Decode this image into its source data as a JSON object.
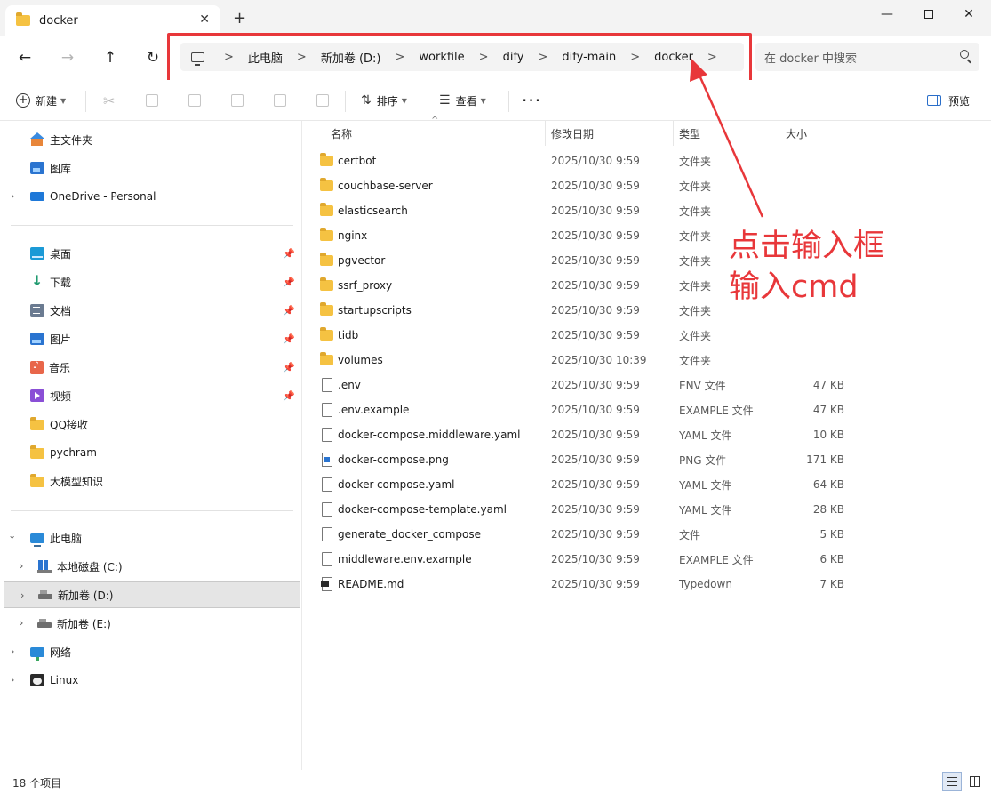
{
  "window": {
    "tab_title": "docker",
    "tab_close": "✕",
    "new_tab": "+",
    "minimize": "—",
    "close": "✕"
  },
  "nav": {
    "back": "←",
    "forward": "→",
    "up": "↑",
    "refresh": "↻"
  },
  "breadcrumb": {
    "separator": ">",
    "items": [
      "此电脑",
      "新加卷 (D:)",
      "workfile",
      "dify",
      "dify-main",
      "docker"
    ]
  },
  "search": {
    "placeholder": "在 docker 中搜索"
  },
  "toolbar": {
    "new_label": "新建",
    "sort_label": "排序",
    "view_label": "查看",
    "more_label": "···",
    "preview_label": "预览"
  },
  "sidebar": {
    "quick": [
      "主文件夹",
      "图库",
      "OneDrive - Personal"
    ],
    "pinned": [
      "桌面",
      "下载",
      "文档",
      "图片",
      "音乐",
      "视频",
      "QQ接收",
      "pychram",
      "大模型知识"
    ],
    "this_pc": "此电脑",
    "drives": [
      "本地磁盘 (C:)",
      "新加卷 (D:)",
      "新加卷 (E:)"
    ],
    "network": "网络",
    "linux": "Linux"
  },
  "columns": {
    "name": "名称",
    "date": "修改日期",
    "type": "类型",
    "size": "大小"
  },
  "files": [
    {
      "name": "certbot",
      "date": "2025/10/30 9:59",
      "type": "文件夹",
      "size": "",
      "icon": "folder-icon"
    },
    {
      "name": "couchbase-server",
      "date": "2025/10/30 9:59",
      "type": "文件夹",
      "size": "",
      "icon": "folder-icon"
    },
    {
      "name": "elasticsearch",
      "date": "2025/10/30 9:59",
      "type": "文件夹",
      "size": "",
      "icon": "folder-icon"
    },
    {
      "name": "nginx",
      "date": "2025/10/30 9:59",
      "type": "文件夹",
      "size": "",
      "icon": "folder-icon"
    },
    {
      "name": "pgvector",
      "date": "2025/10/30 9:59",
      "type": "文件夹",
      "size": "",
      "icon": "folder-icon"
    },
    {
      "name": "ssrf_proxy",
      "date": "2025/10/30 9:59",
      "type": "文件夹",
      "size": "",
      "icon": "folder-icon"
    },
    {
      "name": "startupscripts",
      "date": "2025/10/30 9:59",
      "type": "文件夹",
      "size": "",
      "icon": "folder-icon"
    },
    {
      "name": "tidb",
      "date": "2025/10/30 9:59",
      "type": "文件夹",
      "size": "",
      "icon": "folder-icon"
    },
    {
      "name": "volumes",
      "date": "2025/10/30 10:39",
      "type": "文件夹",
      "size": "",
      "icon": "folder-icon"
    },
    {
      "name": ".env",
      "date": "2025/10/30 9:59",
      "type": "ENV 文件",
      "size": "47 KB",
      "icon": "file-icon"
    },
    {
      "name": ".env.example",
      "date": "2025/10/30 9:59",
      "type": "EXAMPLE 文件",
      "size": "47 KB",
      "icon": "file-icon"
    },
    {
      "name": "docker-compose.middleware.yaml",
      "date": "2025/10/30 9:59",
      "type": "YAML 文件",
      "size": "10 KB",
      "icon": "file-icon"
    },
    {
      "name": "docker-compose.png",
      "date": "2025/10/30 9:59",
      "type": "PNG 文件",
      "size": "171 KB",
      "icon": "image-file-icon"
    },
    {
      "name": "docker-compose.yaml",
      "date": "2025/10/30 9:59",
      "type": "YAML 文件",
      "size": "64 KB",
      "icon": "file-icon"
    },
    {
      "name": "docker-compose-template.yaml",
      "date": "2025/10/30 9:59",
      "type": "YAML 文件",
      "size": "28 KB",
      "icon": "file-icon"
    },
    {
      "name": "generate_docker_compose",
      "date": "2025/10/30 9:59",
      "type": "文件",
      "size": "5 KB",
      "icon": "file-icon"
    },
    {
      "name": "middleware.env.example",
      "date": "2025/10/30 9:59",
      "type": "EXAMPLE 文件",
      "size": "6 KB",
      "icon": "file-icon"
    },
    {
      "name": "README.md",
      "date": "2025/10/30 9:59",
      "type": "Typedown",
      "size": "7 KB",
      "icon": "markdown-file-icon"
    }
  ],
  "annotation": {
    "line1": "点击输入框",
    "line2": "输入cmd",
    "color": "#e8373a"
  },
  "status": {
    "count": "18 个项目"
  },
  "colors": {
    "accent": "#2a74d0",
    "annotation_red": "#e8373a",
    "folder": "#f5c242"
  }
}
